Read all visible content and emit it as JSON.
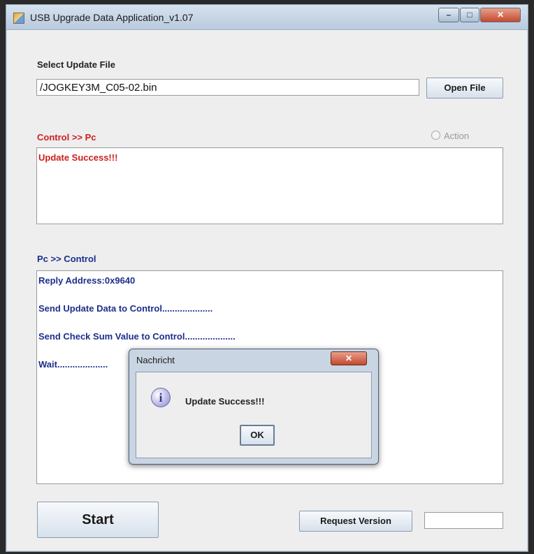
{
  "window": {
    "title": "USB Upgrade Data Application_v1.07",
    "controls": {
      "minimize": "–",
      "maximize": "□",
      "close": "✕"
    }
  },
  "file_section": {
    "label": "Select Update File",
    "file_path": "/JOGKEY3M_C05-02.bin",
    "open_button": "Open File"
  },
  "control_to_pc": {
    "label": "Control >> Pc",
    "action_radio_label": "Action",
    "action_selected": false,
    "log": [
      "Update Success!!!"
    ]
  },
  "pc_to_control": {
    "label": "Pc >> Control",
    "log": [
      "Reply Address:0x9640",
      "Send Update Data to Control....................",
      "Send Check Sum Value to Control....................",
      "Wait...................."
    ]
  },
  "footer": {
    "start_button": "Start",
    "request_version_button": "Request Version",
    "version_value": ""
  },
  "dialog": {
    "title": "Nachricht",
    "close": "✕",
    "icon": "info-icon",
    "icon_glyph": "i",
    "message": "Update Success!!!",
    "ok_button": "OK"
  },
  "colors": {
    "control_label": "#cc1f1f",
    "pc_label": "#1c2f8c"
  }
}
